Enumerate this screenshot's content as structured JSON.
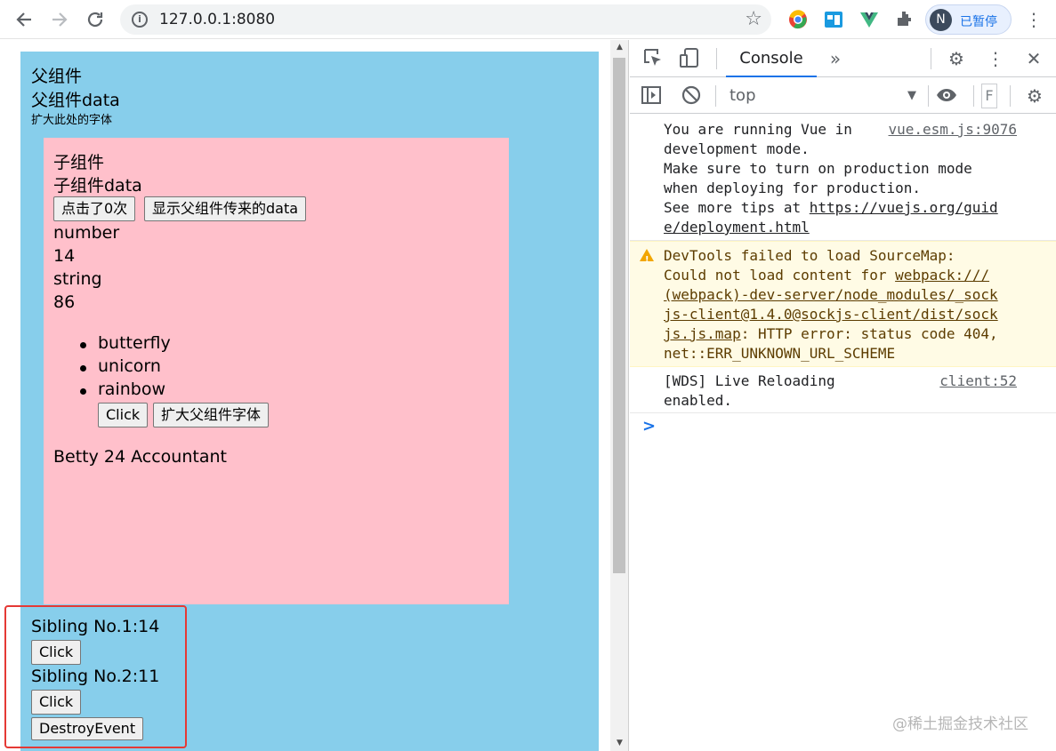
{
  "browser": {
    "url": "127.0.0.1:8080",
    "profile_initial": "N",
    "profile_status": "已暂停",
    "icons": [
      "back-arrow-icon",
      "forward-arrow-icon",
      "reload-icon",
      "site-info-icon",
      "star-icon",
      "extension-icon",
      "kebab-menu-icon"
    ]
  },
  "page": {
    "parent_title": "父组件",
    "parent_data": "父组件data",
    "parent_small_text": "扩大此处的字体",
    "child": {
      "title": "子组件",
      "data_label": "子组件data",
      "click_count_button": "点击了0次",
      "show_parent_data_button": "显示父组件传来的data",
      "number_label": "number",
      "number_value": "14",
      "string_label": "string",
      "string_value": "86",
      "list_items": [
        "butterfly",
        "unicorn",
        "rainbow"
      ],
      "click_button": "Click",
      "enlarge_parent_font_button": "扩大父组件字体",
      "person_info": "Betty 24 Accountant"
    },
    "siblings": {
      "sibling1": "Sibling No.1:14",
      "sibling1_button": "Click",
      "sibling2": "Sibling No.2:11",
      "sibling2_button": "Click",
      "destroy_button": "DestroyEvent"
    },
    "colors": {
      "parent_bg": "#87ceeb",
      "child_bg": "#ffc0cb",
      "highlight_frame": "#e53935"
    }
  },
  "devtools": {
    "active_tab": "Console",
    "context": "top",
    "filter_placeholder": "F",
    "messages": [
      {
        "type": "log",
        "text_lines": [
          "You are running Vue in ",
          "development mode.",
          "Make sure to turn on production mode",
          "when deploying for production.",
          "See more tips at "
        ],
        "link": "https://vuejs.org/guid",
        "link2": "e/deployment.html",
        "source": "vue.esm.js:9076"
      },
      {
        "type": "warning",
        "line1": "DevTools failed to load SourceMap:",
        "line2a": "Could not load content for ",
        "link_a": "webpack:///",
        "link_b": "(webpack)-dev-server/node_modules/_sock",
        "link_c": "js-client@1.4.0@sockjs-client/dist/sock",
        "link_d": "js.js.map",
        "line3": ": HTTP error: status code 404,",
        "line4": "net::ERR_UNKNOWN_URL_SCHEME"
      },
      {
        "type": "log",
        "line1": "[WDS] Live Reloading",
        "line2": "enabled.",
        "source": "client:52"
      }
    ],
    "prompt_symbol": ">"
  },
  "watermark": "@稀土掘金技术社区"
}
